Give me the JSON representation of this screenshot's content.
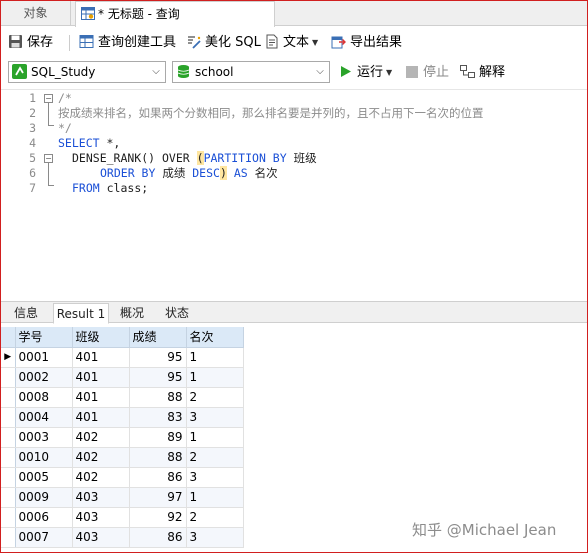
{
  "tabs": {
    "objects_label": "对象",
    "query_tab_label": "* 无标题 - 查询"
  },
  "toolbar": {
    "save_label": "保存",
    "query_builder_label": "查询创建工具",
    "beautify_label": "美化 SQL",
    "text_label": "文本",
    "export_label": "导出结果"
  },
  "connection": {
    "connection_value": "SQL_Study",
    "database_value": "school",
    "run_label": "运行",
    "stop_label": "停止",
    "explain_label": "解释"
  },
  "editor": {
    "line_numbers": [
      "1",
      "2",
      "3",
      "4",
      "5",
      "6",
      "7"
    ],
    "line1": "/*",
    "line2": "按成绩来排名，如果两个分数相同，那么排名要是并列的，且不占用下一名次的位置",
    "line3": "*/",
    "line4_kw": "SELECT",
    "line4_rest": " *,",
    "line5_a": "DENSE_RANK() OVER ",
    "line5_paren": "(",
    "line5_kw": "PARTITION BY",
    "line5_rest": " 班级",
    "line6_kw": "ORDER BY",
    "line6_mid": " 成绩 ",
    "line6_kw2": "DESC",
    "line6_paren": ")",
    "line6_kw3": " AS",
    "line6_rest": " 名次",
    "line7_kw": "FROM",
    "line7_rest": " class;"
  },
  "result_tabs": [
    "信息",
    "Result 1",
    "概况",
    "状态"
  ],
  "result": {
    "columns": [
      "学号",
      "班级",
      "成绩",
      "名次"
    ],
    "rows": [
      [
        "0001",
        "401",
        "95",
        "1"
      ],
      [
        "0002",
        "401",
        "95",
        "1"
      ],
      [
        "0008",
        "401",
        "88",
        "2"
      ],
      [
        "0004",
        "401",
        "83",
        "3"
      ],
      [
        "0003",
        "402",
        "89",
        "1"
      ],
      [
        "0010",
        "402",
        "88",
        "2"
      ],
      [
        "0005",
        "402",
        "86",
        "3"
      ],
      [
        "0009",
        "403",
        "97",
        "1"
      ],
      [
        "0006",
        "403",
        "92",
        "2"
      ],
      [
        "0007",
        "403",
        "86",
        "3"
      ]
    ]
  },
  "watermark": "知乎 @Michael Jean",
  "colors": {
    "keyword": "#1a4fd6",
    "comment": "#8c8c8c",
    "header_bg": "#dbe9f7",
    "run_green": "#2aa32a"
  }
}
